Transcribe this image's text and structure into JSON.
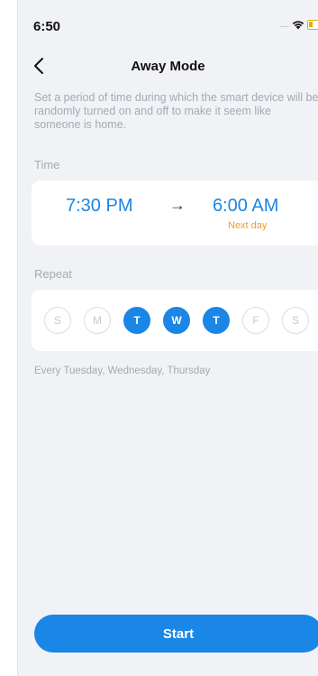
{
  "status_bar": {
    "time": "6:50",
    "signal": "....",
    "wifi_icon": "wifi-icon",
    "battery_icon": "battery-icon"
  },
  "nav": {
    "back_icon": "chevron-left-icon",
    "title": "Away Mode"
  },
  "description": "Set a period of time during which the smart device will be randomly turned on and off to make it seem like someone is home.",
  "time_section": {
    "label": "Time",
    "start": "7:30 PM",
    "arrow": "→",
    "end": "6:00 AM",
    "end_note": "Next day",
    "accent_color": "#1a86e5",
    "note_color": "#f39a2b"
  },
  "repeat_section": {
    "label": "Repeat",
    "days": [
      {
        "letter": "S",
        "selected": false
      },
      {
        "letter": "M",
        "selected": false
      },
      {
        "letter": "T",
        "selected": true
      },
      {
        "letter": "W",
        "selected": true
      },
      {
        "letter": "T",
        "selected": true
      },
      {
        "letter": "F",
        "selected": false
      },
      {
        "letter": "S",
        "selected": false
      }
    ],
    "summary": "Every Tuesday, Wednesday, Thursday"
  },
  "actions": {
    "start_label": "Start"
  }
}
